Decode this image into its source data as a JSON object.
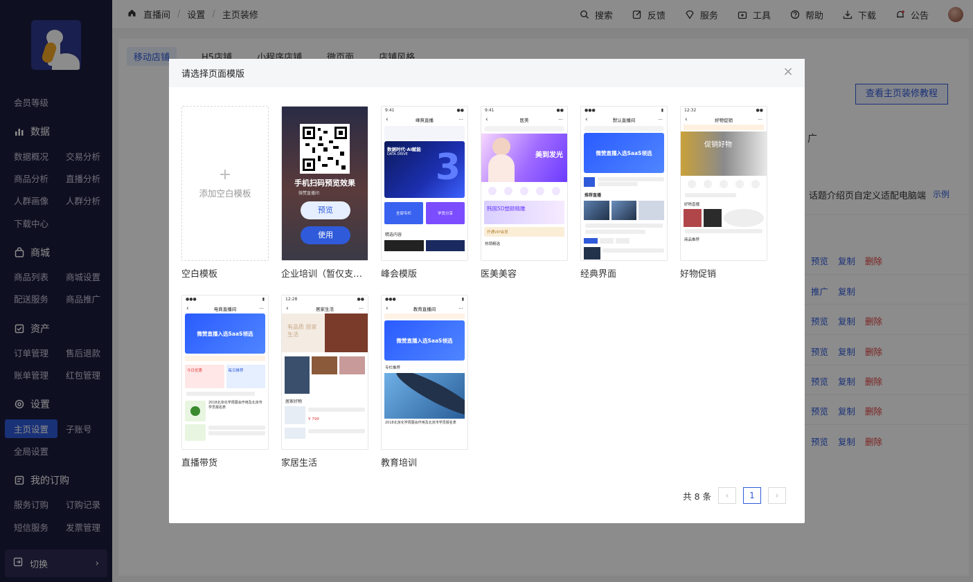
{
  "sidebar": {
    "top_item": "会员等级",
    "sections": [
      {
        "title": "数据",
        "icon": "bar-chart-icon",
        "items": [
          "数据概况",
          "交易分析",
          "商品分析",
          "直播分析",
          "人群画像",
          "人群分析",
          "下载中心"
        ]
      },
      {
        "title": "商城",
        "icon": "shop-icon",
        "items": [
          "商品列表",
          "商城设置",
          "配送服务",
          "商品推广"
        ]
      },
      {
        "title": "资产",
        "icon": "asset-icon",
        "items": [
          "订单管理",
          "售后退款",
          "账单管理",
          "红包管理"
        ]
      },
      {
        "title": "设置",
        "icon": "gear-icon",
        "items": [
          "主页设置",
          "子账号",
          "全局设置"
        ]
      },
      {
        "title": "我的订购",
        "icon": "order-icon",
        "items": [
          "服务订购",
          "订购记录",
          "短信服务",
          "发票管理"
        ]
      }
    ],
    "switch_label": "切换",
    "switch_chevron": "›"
  },
  "topbar": {
    "breadcrumb": [
      "直播间",
      "设置",
      "主页装修"
    ],
    "actions": [
      "搜索",
      "反馈",
      "服务",
      "工具",
      "帮助",
      "下载",
      "公告"
    ]
  },
  "page": {
    "tabs": [
      "移动店铺",
      "H5店铺",
      "小程序店铺",
      "微页面",
      "店铺风格"
    ],
    "tutorial_button": "查看主页装修教程",
    "guang": "广",
    "topic_text": "话题介绍页自定义适配电脑端",
    "example_link": "示例",
    "row_actions": [
      [
        "预览",
        "复制",
        "删除"
      ],
      [
        "推广",
        "复制"
      ],
      [
        "预览",
        "复制",
        "删除"
      ],
      [
        "预览",
        "复制",
        "删除"
      ],
      [
        "预览",
        "复制",
        "删除"
      ],
      [
        "预览",
        "复制",
        "删除"
      ],
      [
        "预览",
        "复制",
        "删除"
      ]
    ]
  },
  "modal": {
    "title": "请选择页面模版",
    "close": "×",
    "blank_template": {
      "plus": "+",
      "label": "添加空白模板",
      "name": "空白模板"
    },
    "templates": [
      {
        "name": "企业培训（暂仅支持小程序）",
        "overlay": "手机扫码预览效果",
        "preview": "预览",
        "use": "使用",
        "preview_subtitle": "微赞直播间"
      },
      {
        "name": "峰会模版",
        "nav": "峰爽直播",
        "banner": "数据时代·AI赋能",
        "banner_sub": "DATA DRIVE",
        "tiles": [
          "全部专栏",
          "学员分享"
        ],
        "section": "精选内容"
      },
      {
        "name": "医美美容",
        "nav": "医美",
        "banner": "美到发光",
        "promo": "韩国5D塑颜精雕",
        "vip": "开通VIP会员",
        "section": "热销精选"
      },
      {
        "name": "经典界面",
        "nav": "默认直播间",
        "banner": "微赞直播入选SaaS领选",
        "section": "推荐直播"
      },
      {
        "name": "好物促销",
        "nav": "好物促销",
        "banner": "促销好物",
        "section": "好物直播",
        "section2": "商品推荐"
      },
      {
        "name": "直播带货",
        "nav": "电商直播间",
        "banner": "微赞直播入选SaaS领选",
        "cards": [
          "今日优惠",
          "每日推荐"
        ],
        "item": "2018北京化学周展会作用及北京市学员报名表"
      },
      {
        "name": "家居生活",
        "nav": "居家生活",
        "banner": "有品质 居家生活",
        "section": "居家好物",
        "price": "¥ 799"
      },
      {
        "name": "教育培训",
        "nav": "教育直播间",
        "banner": "微赞直播入选SaaS领选",
        "section": "专栏推荐",
        "item": "2018北京化学周展会作用及北京市学员报名表"
      }
    ],
    "pagination": {
      "total": "共 8 条",
      "current": "1",
      "prev": "‹",
      "next": "›"
    }
  },
  "colors": {
    "sidebar_bg": "#1d1c3f",
    "accent": "#2f5ad9",
    "danger": "#e23c3c"
  }
}
